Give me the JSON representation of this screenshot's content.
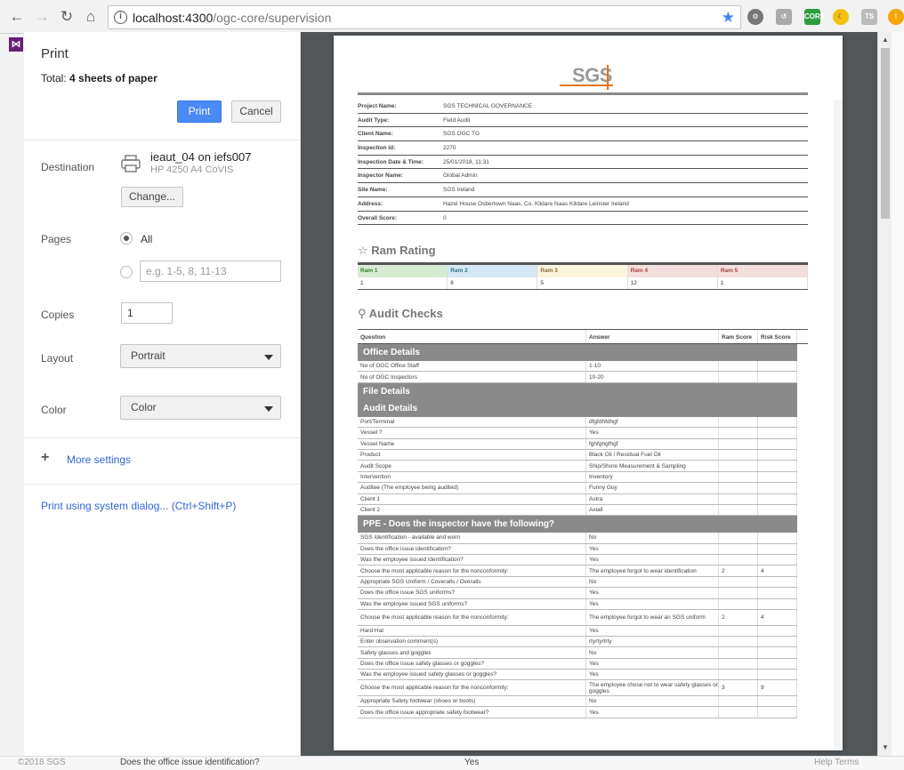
{
  "browser": {
    "url_host": "localhost:4300",
    "url_path": "/ogc-core/supervision",
    "ext_cors": "CORS",
    "ext_ts": "TS",
    "ext_alert": "!"
  },
  "print": {
    "title": "Print",
    "total_label": "Total:",
    "total_value": "4 sheets of paper",
    "print_button": "Print",
    "cancel_button": "Cancel",
    "destination_label": "Destination",
    "printer_name": "ieaut_04 on iefs007",
    "printer_model": "HP 4250 A4 CoVIS",
    "change_button": "Change...",
    "pages_label": "Pages",
    "pages_all": "All",
    "pages_placeholder": "e.g. 1-5, 8, 11-13",
    "copies_label": "Copies",
    "copies_value": "1",
    "layout_label": "Layout",
    "layout_value": "Portrait",
    "color_label": "Color",
    "color_value": "Color",
    "more_settings": "More settings",
    "system_dialog": "Print using system dialog... (Ctrl+Shift+P)"
  },
  "report": {
    "logo": "SGS",
    "info": [
      {
        "k": "Project Name:",
        "v": "SGS TECHNICAL GOVERNANCE"
      },
      {
        "k": "Audit Type:",
        "v": "Field Audit"
      },
      {
        "k": "Client Name:",
        "v": "SGS OGC TG"
      },
      {
        "k": "Inspection Id:",
        "v": "2270"
      },
      {
        "k": "Inspection Date & Time:",
        "v": "25/01/2018, 11:31"
      },
      {
        "k": "Inspector Name:",
        "v": "Global Admin"
      },
      {
        "k": "Site Name:",
        "v": "SGS Ireland"
      },
      {
        "k": "Address:",
        "v": "Hazel House Osbertown Naas, Co. Kildare Naas Kildare Leinster Ireland"
      },
      {
        "k": "Overall Score:",
        "v": "0"
      }
    ],
    "ram_heading": "Ram Rating",
    "ram": [
      {
        "name": "Ram 1",
        "value": "1",
        "bg": "#d6ecd2",
        "fg": "#3a7d33"
      },
      {
        "name": "Ram 2",
        "value": "6",
        "bg": "#d5e8f5",
        "fg": "#31708f"
      },
      {
        "name": "Ram 3",
        "value": "5",
        "bg": "#fcf4dc",
        "fg": "#8a6d3b"
      },
      {
        "name": "Ram 4",
        "value": "12",
        "bg": "#f5dede",
        "fg": "#a94442"
      },
      {
        "name": "Ram 5",
        "value": "1",
        "bg": "#f5dede",
        "fg": "#a94442"
      }
    ],
    "checks_heading": "Audit Checks",
    "cols": {
      "question": "Question",
      "answer": "Answer",
      "ram": "Ram Score",
      "risk": "Risk Score"
    },
    "groups": [
      {
        "title": "Office Details",
        "rows": [
          {
            "q": "No of OGC Office Staff",
            "a": "1-10",
            "r": "",
            "s": ""
          },
          {
            "q": "No of OGC Inspectors",
            "a": "10-20",
            "r": "",
            "s": ""
          }
        ]
      },
      {
        "title": "File Details",
        "rows": []
      },
      {
        "title": "Audit Details",
        "rows": [
          {
            "q": "Port/Terminal",
            "a": "dfgfdhfdhgf",
            "r": "",
            "s": ""
          },
          {
            "q": "Vessel ?",
            "a": "Yes",
            "r": "",
            "s": ""
          },
          {
            "q": "Vessel Name",
            "a": "fghfghgfhgf",
            "r": "",
            "s": ""
          },
          {
            "q": "Product",
            "a": "Black Oil / Residual Fuel Oil",
            "r": "",
            "s": ""
          },
          {
            "q": "Audit Scope",
            "a": "Ship/Shore Measurement & Sampling",
            "r": "",
            "s": ""
          },
          {
            "q": "Intervention",
            "a": "Inventory",
            "r": "",
            "s": ""
          },
          {
            "q": "Auditee (The employee being audited)",
            "a": "Funny Guy",
            "r": "",
            "s": ""
          },
          {
            "q": "Client 1",
            "a": "Astra",
            "r": "",
            "s": ""
          },
          {
            "q": "Client 2",
            "a": "Axiall",
            "r": "",
            "s": ""
          }
        ]
      },
      {
        "title": "PPE - Does the inspector have the following?",
        "rows": [
          {
            "q": "SGS Identification - available and worn",
            "a": "No",
            "r": "",
            "s": ""
          },
          {
            "q": "Does the office issue identification?",
            "a": "Yes",
            "r": "",
            "s": ""
          },
          {
            "q": "Was the employee issued identification?",
            "a": "Yes",
            "r": "",
            "s": ""
          },
          {
            "q": "Choose the most applicable reason for the nonconformity:",
            "a": "The employee forgot to wear identification",
            "r": "2",
            "s": "4"
          },
          {
            "q": "Appropriate SGS Uniform / Coveralls / Overalls",
            "a": "No",
            "r": "",
            "s": ""
          },
          {
            "q": "Does the office issue SGS uniforms?",
            "a": "Yes",
            "r": "",
            "s": ""
          },
          {
            "q": "Was the employee issued SGS uniforms?",
            "a": "Yes",
            "r": "",
            "s": ""
          },
          {
            "q": "Choose the most applicable reason for the nonconformity:",
            "a": "The employee forgot to wear an SGS uniform",
            "r": "2",
            "s": "4",
            "tall": true
          },
          {
            "q": "Hard Hat",
            "a": "Yes",
            "r": "",
            "s": ""
          },
          {
            "q": "Enter observation comment(s)",
            "a": "rtyrtyrtrty",
            "r": "",
            "s": ""
          },
          {
            "q": "Safety glasses and goggles",
            "a": "No",
            "r": "",
            "s": ""
          },
          {
            "q": "Does the office issue safety glasses or goggles?",
            "a": "Yes",
            "r": "",
            "s": ""
          },
          {
            "q": "Was the employee issued safety glasses or goggles?",
            "a": "Yes",
            "r": "",
            "s": ""
          },
          {
            "q": "Choose the most applicable reason for the nonconformity:",
            "a": "The employee chose not to wear safety glasses or goggles",
            "r": "3",
            "s": "9",
            "tall": true
          },
          {
            "q": "Appropriate Safety footwear (shoes or boots)",
            "a": "No",
            "r": "",
            "s": ""
          },
          {
            "q": "Does the office issue appropriate safety footwear?",
            "a": "Yes",
            "r": "",
            "s": ""
          }
        ]
      }
    ]
  },
  "background": {
    "bottom_left": "©2018 SGS",
    "bottom_question": "Does the office issue identification?",
    "bottom_answer": "Yes",
    "bottom_right": "Help  Terms"
  }
}
